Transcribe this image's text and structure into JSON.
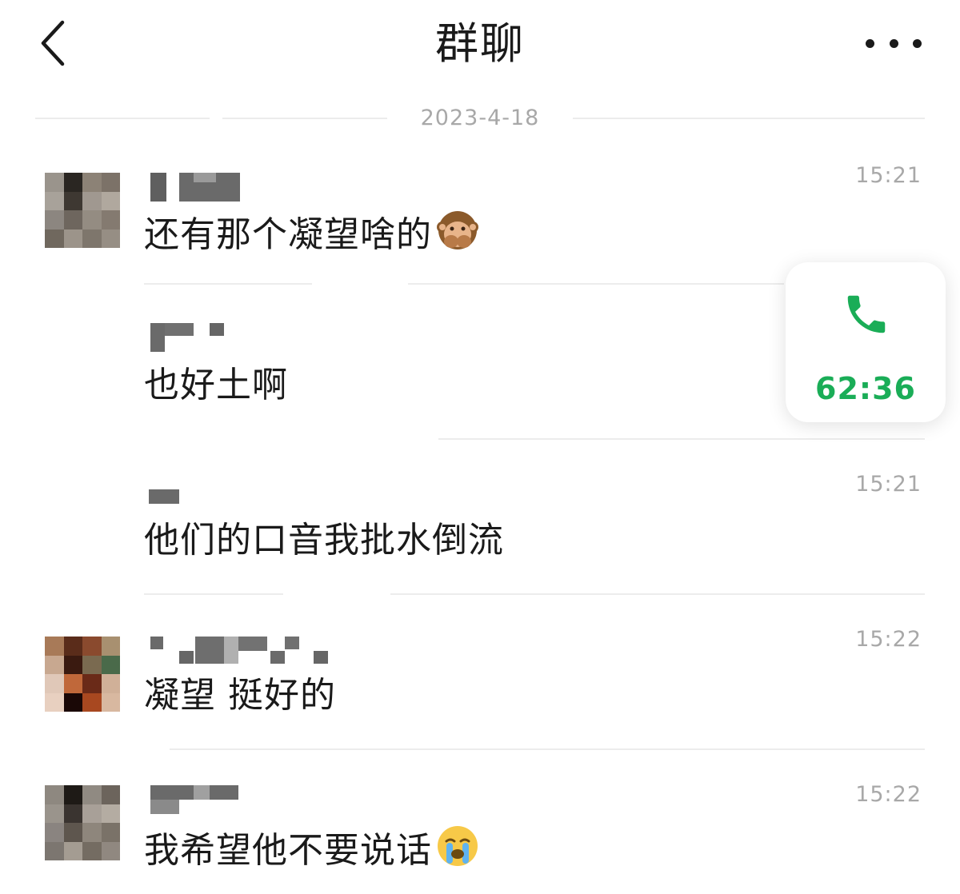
{
  "header": {
    "title": "群聊",
    "back_icon": "chevron-left-icon",
    "more_icon": "more-dots-icon"
  },
  "date_divider": "2023-4-18",
  "messages": [
    {
      "time": "15:21",
      "text": "还有那个凝望啥的",
      "emoji": "see-no-evil-monkey-emoji"
    },
    {
      "time": "",
      "text": "也好土啊"
    },
    {
      "time": "15:21",
      "text": "他们的口音我批水倒流"
    },
    {
      "time": "15:22",
      "text": "凝望 挺好的"
    },
    {
      "time": "15:22",
      "text": "我希望他不要说话",
      "emoji": "crying-face-emoji"
    }
  ],
  "call_widget": {
    "icon": "phone-icon",
    "duration": "62:36",
    "accent_color": "#1aad57"
  }
}
